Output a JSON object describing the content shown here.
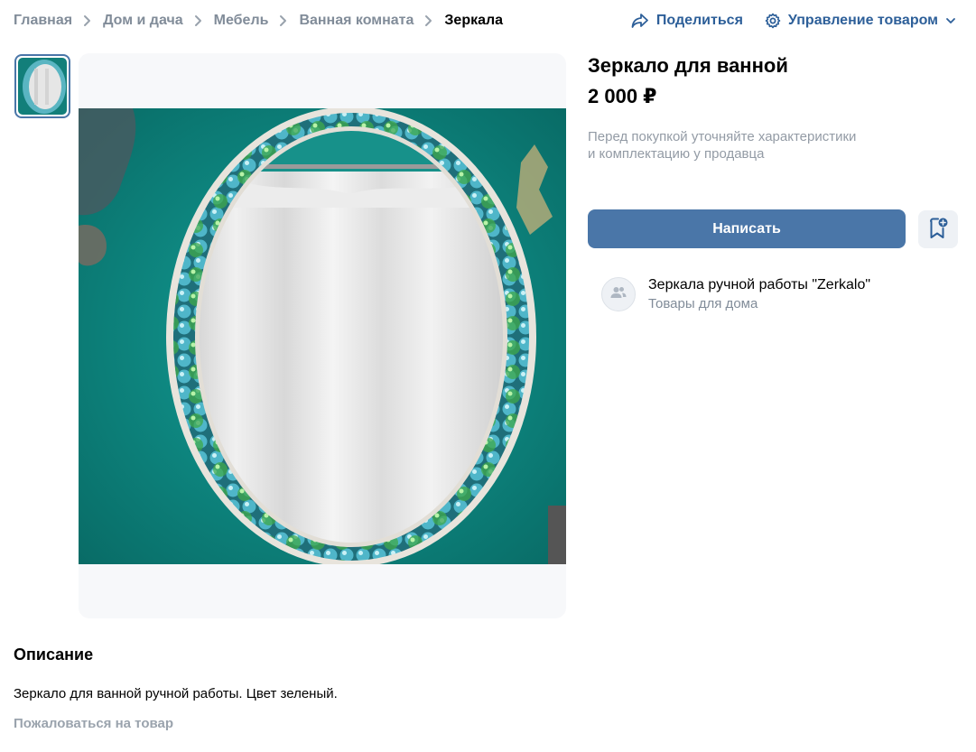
{
  "breadcrumbs": {
    "items": [
      {
        "label": "Главная"
      },
      {
        "label": "Дом и дача"
      },
      {
        "label": "Мебель"
      },
      {
        "label": "Ванная комната"
      },
      {
        "label": "Зеркала"
      }
    ]
  },
  "actions": {
    "share_label": "Поделиться",
    "manage_label": "Управление товаром"
  },
  "product": {
    "title": "Зеркало для ванной",
    "price": "2 000 ₽",
    "notice_line1": "Перед покупкой уточняйте характеристики",
    "notice_line2": "и комплектацию у продавца",
    "write_label": "Написать"
  },
  "seller": {
    "name": "Зеркала ручной работы \"Zerkalo\"",
    "category": "Товары для дома"
  },
  "description": {
    "heading": "Описание",
    "text": "Зеркало для ванной ручной работы. Цвет зеленый.",
    "report_label": "Пожаловаться на товар"
  },
  "colors": {
    "accent": "#4a76a8",
    "link": "#2d5f99",
    "muted": "#818c99",
    "teal_wall": "#0e8a84"
  },
  "icons": {
    "share": "share-arrow-icon",
    "manage": "gear-icon",
    "chevron": "chevron-down-icon",
    "bookmark": "bookmark-add-icon",
    "seller": "group-icon"
  }
}
